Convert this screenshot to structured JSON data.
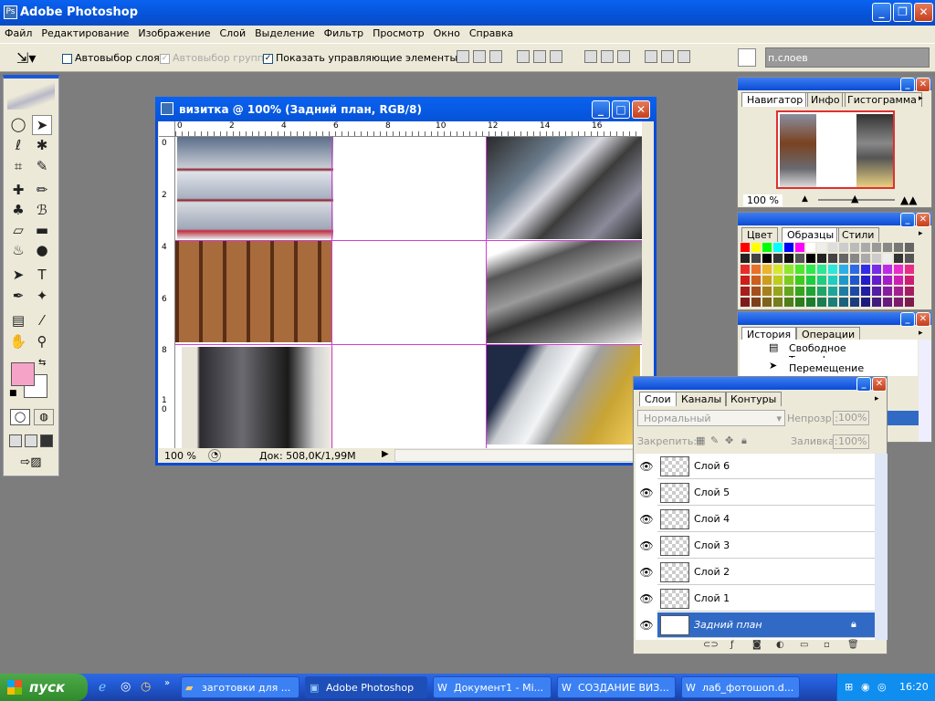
{
  "app": {
    "title": "Adobe Photoshop"
  },
  "menu": [
    "Файл",
    "Редактирование",
    "Изображение",
    "Слой",
    "Выделение",
    "Фильтр",
    "Просмотр",
    "Окно",
    "Справка"
  ],
  "options": {
    "auto_select_layer": "Автовыбор слоя",
    "auto_select_groups": "Автовыбор групп",
    "show_controls": "Показать управляющие элементы",
    "palette_well": "п.слоев"
  },
  "document": {
    "title": "визитка @ 100% (Задний план, RGB/8)",
    "zoom": "100 %",
    "doc_info": "Док: 508,0K/1,99M",
    "ruler_h": [
      "0",
      "2",
      "4",
      "6",
      "8",
      "10",
      "12",
      "14",
      "16"
    ],
    "ruler_v": [
      "0",
      "2",
      "4",
      "6",
      "8",
      "1\n0"
    ]
  },
  "navigator": {
    "tabs": [
      "Навигатор",
      "Инфо",
      "Гистограмма"
    ],
    "zoom": "100 %"
  },
  "swatches": {
    "tabs": [
      "Цвет",
      "Образцы",
      "Стили"
    ]
  },
  "history": {
    "tabs": [
      "История",
      "Операции"
    ],
    "items": [
      "Свободное Трансформи...",
      "Перемещение"
    ]
  },
  "layers": {
    "tabs": [
      "Слои",
      "Каналы",
      "Контуры"
    ],
    "blend_mode": "Нормальный",
    "opacity_label": "Непрозр.:",
    "opacity_value": "100%",
    "lock_label": "Закрепить:",
    "fill_label": "Заливка:",
    "fill_value": "100%",
    "items": [
      "Слой 6",
      "Слой 5",
      "Слой 4",
      "Слой 3",
      "Слой 2",
      "Слой 1",
      "Задний план"
    ]
  },
  "taskbar": {
    "start": "пуск",
    "tasks": [
      "заготовки для ...",
      "Adobe Photoshop",
      "Документ1 - Mi...",
      "СОЗДАНИЕ ВИЗ...",
      "лаб_фотошоп.d..."
    ],
    "clock": "16:20"
  }
}
